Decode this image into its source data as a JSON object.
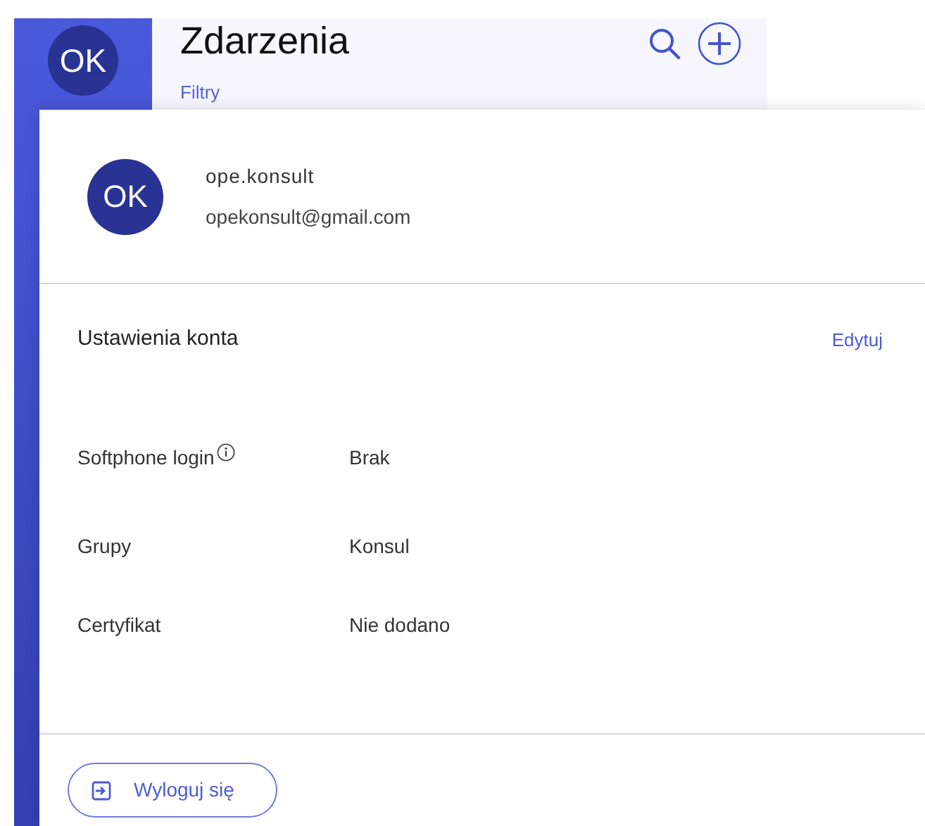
{
  "sidebar": {
    "avatar_initials": "OK"
  },
  "header": {
    "title": "Zdarzenia",
    "filter_link": "Filtry"
  },
  "account_panel": {
    "avatar_initials": "OK",
    "username": "ope.konsult",
    "email": "opekonsult@gmail.com",
    "section_title": "Ustawienia konta",
    "edit_link": "Edytuj",
    "fields": [
      {
        "label": "Softphone login",
        "info": true,
        "value": "Brak"
      },
      {
        "label": "Grupy",
        "info": false,
        "value": "Konsul"
      },
      {
        "label": "Certyfikat",
        "info": false,
        "value": "Nie dodano"
      }
    ],
    "logout_button": "Wyloguj się"
  }
}
